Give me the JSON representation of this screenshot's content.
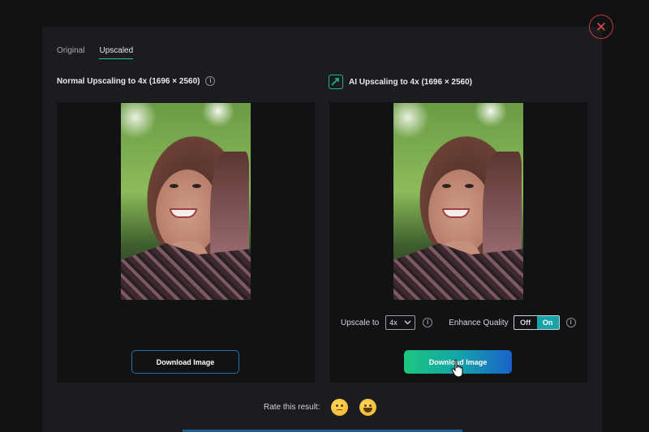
{
  "tabs": [
    {
      "label": "Original",
      "active": false
    },
    {
      "label": "Upscaled",
      "active": true
    }
  ],
  "close": {
    "symbol": "✕"
  },
  "normal": {
    "title": "Normal Upscaling to 4x (1696 × 2560)",
    "download_label": "Download Image"
  },
  "ai": {
    "title": "AI Upscaling to 4x (1696 × 2560)",
    "download_label": "Download Image",
    "upscale_label": "Upscale to",
    "upscale_value": "4x",
    "enhance_label": "Enhance Quality",
    "toggle_off": "Off",
    "toggle_on": "On"
  },
  "rate": {
    "label": "Rate this result:"
  },
  "colors": {
    "accent_green": "#22c48a",
    "close_red": "#e24848",
    "gradient_start": "#1dc77e",
    "gradient_end": "#1a62c9"
  },
  "icons": {
    "close": "close-icon",
    "info": "info-icon",
    "ai_upscale": "ai-upscale-icon",
    "dropdown": "chevron-down-icon",
    "sad": "disappointed-face-icon",
    "happy": "grinning-face-icon",
    "cursor": "hand-pointer-icon"
  }
}
